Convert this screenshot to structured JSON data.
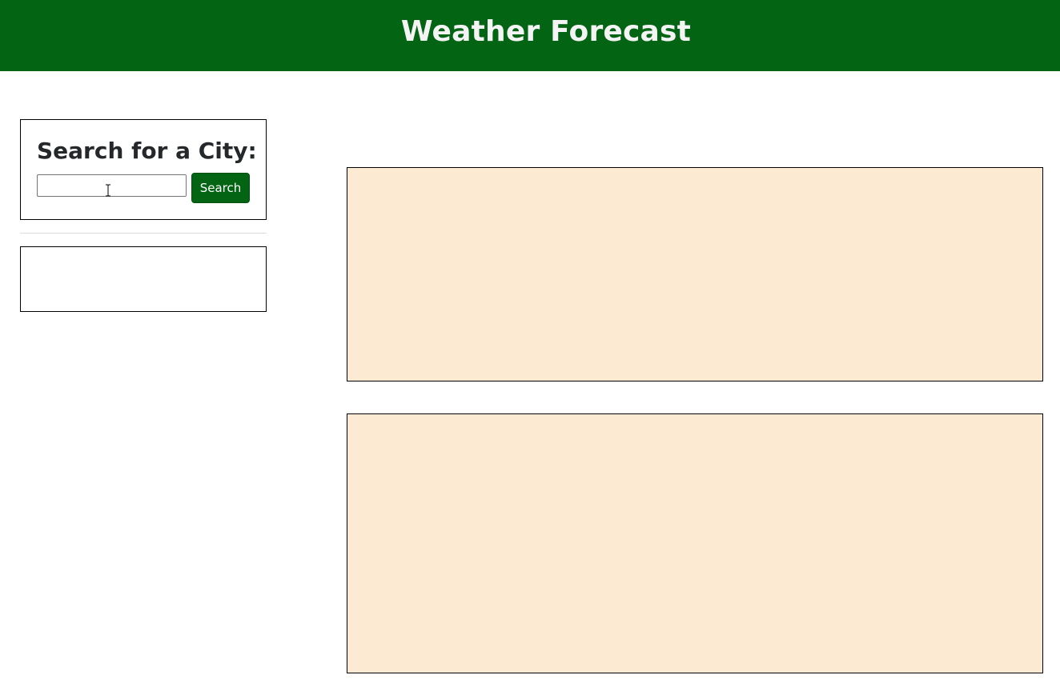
{
  "header": {
    "title": "Weather Forecast"
  },
  "search": {
    "heading": "Search for a City:",
    "input_value": "",
    "button_label": "Search"
  },
  "history": {
    "items": []
  },
  "colors": {
    "brand": "#036414",
    "card_background": "#fdead3",
    "border": "#000000"
  },
  "icons": {
    "cursor": "text-cursor-icon"
  }
}
